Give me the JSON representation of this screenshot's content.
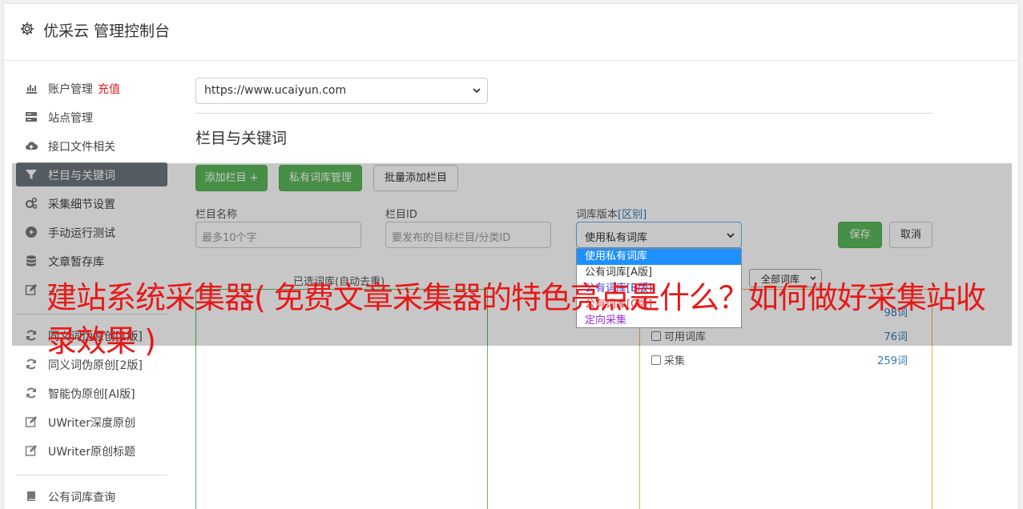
{
  "header": {
    "title": "优采云 管理控制台",
    "icon": "gear-icon"
  },
  "sidebar": {
    "items": [
      {
        "label": "账户管理",
        "extra": "充值",
        "icon": "bar-chart-icon"
      },
      {
        "label": "站点管理",
        "icon": "server-icon"
      },
      {
        "label": "接口文件相关",
        "icon": "cloud-upload-icon"
      },
      {
        "label": "栏目与关键词",
        "icon": "filter-icon",
        "active": true
      },
      {
        "label": "采集细节设置",
        "icon": "cogs-icon"
      },
      {
        "label": "手动运行测试",
        "icon": "play-circle-icon"
      },
      {
        "label": "文章暂存库",
        "icon": "database-icon"
      },
      {
        "label": "...",
        "icon": "edit-icon"
      },
      {
        "label": "同义词伪原创[1版]",
        "icon": "refresh-icon"
      },
      {
        "label": "同义词伪原创[2版]",
        "icon": "refresh-icon"
      },
      {
        "label": "智能伪原创[AI版]",
        "icon": "refresh-icon"
      },
      {
        "label": "UWriter深度原创",
        "icon": "edit-icon"
      },
      {
        "label": "UWriter原创标题",
        "icon": "edit-icon"
      },
      {
        "label": "公有词库查询",
        "icon": "book-icon"
      }
    ]
  },
  "main": {
    "site_select": "https://www.ucaiyun.com",
    "section_title": "栏目与关键词",
    "buttons": {
      "add_column": "添加栏目 +",
      "private_lib": "私有词库管理",
      "batch_add": "批量添加栏目",
      "save": "保存",
      "cancel": "取消"
    },
    "form": {
      "column_name_label": "栏目名称",
      "column_name_placeholder": "最多10个字",
      "column_id_label": "栏目ID",
      "column_id_placeholder": "要发布的目标栏目/分类ID",
      "lib_version_label": "词库版本",
      "lib_version_link": "[区别]",
      "lib_version_value": "使用私有词库"
    },
    "dropdown_options": [
      {
        "label": "使用私有词库",
        "color": "#ffffff",
        "selected": true
      },
      {
        "label": "公有词库[A版]",
        "color": "#333333"
      },
      {
        "label": "公有词库[B版]",
        "color": "#3b3bd6"
      },
      {
        "label": "公有词库[C版]",
        "color": "#d43f3f"
      },
      {
        "label": "定向采集",
        "color": "#9b30d9"
      }
    ],
    "selected_libs_label": "已选词库(自动去重)",
    "lib_filter": "全部词库",
    "libraries": [
      {
        "name": "...",
        "count": "98词"
      },
      {
        "name": "可用词库",
        "count": "76词"
      },
      {
        "name": "采集",
        "count": "259词"
      }
    ]
  },
  "caption": "建站系统采集器( 免费文章采集器的特色亮点是什么？如何做好采集站收录效果 )",
  "colors": {
    "green": "#5cb85c",
    "active_nav": "#6c757d",
    "caption_red": "#e81818"
  }
}
